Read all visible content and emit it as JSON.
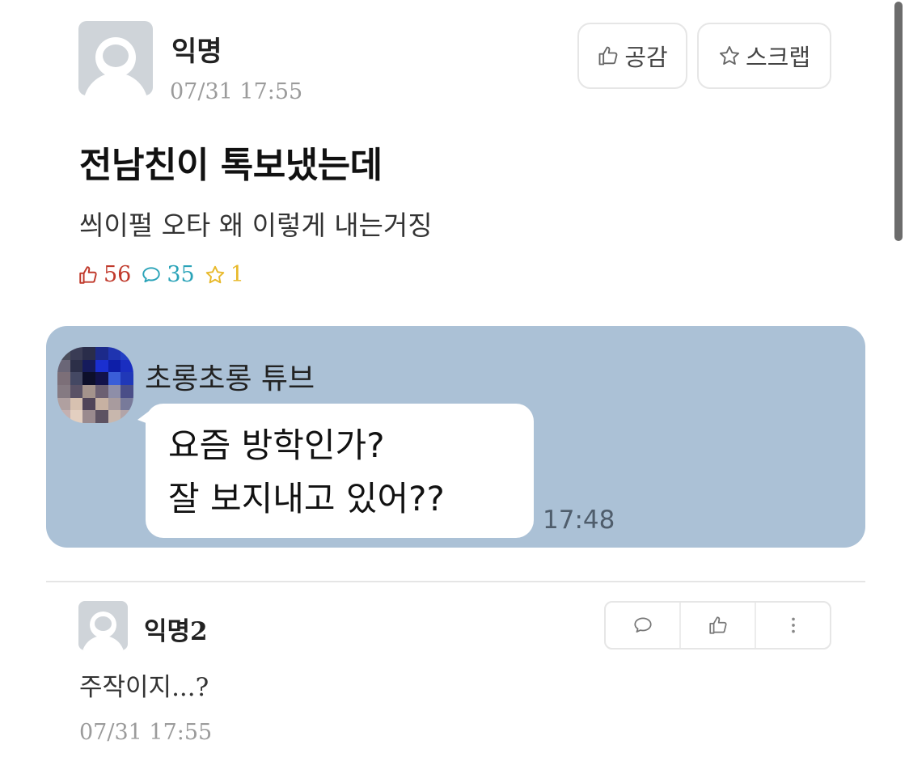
{
  "post": {
    "author": "익명",
    "time": "07/31 17:55",
    "like_button": "공감",
    "scrap_button": "스크랩",
    "title": "전남친이 톡보냈는데",
    "body": "씌이펄 오타 왜 이렇게 내는거징",
    "stats": {
      "likes": "56",
      "comments": "35",
      "scraps": "1"
    }
  },
  "chat": {
    "sender": "초롱초롱 튜브",
    "line1": "요즘 방학인가?",
    "line2": "잘 보지내고 있어??",
    "time": "17:48"
  },
  "comment": {
    "author": "익명2",
    "text": "주작이지...?",
    "time": "07/31 17:55"
  },
  "colors": {
    "chat_bg": "#abc1d6",
    "like": "#c0392b",
    "comment": "#2aa3b8",
    "scrap": "#e8b92a"
  },
  "icons": [
    "thumbs-up-icon",
    "star-icon",
    "comment-icon",
    "more-icon"
  ]
}
